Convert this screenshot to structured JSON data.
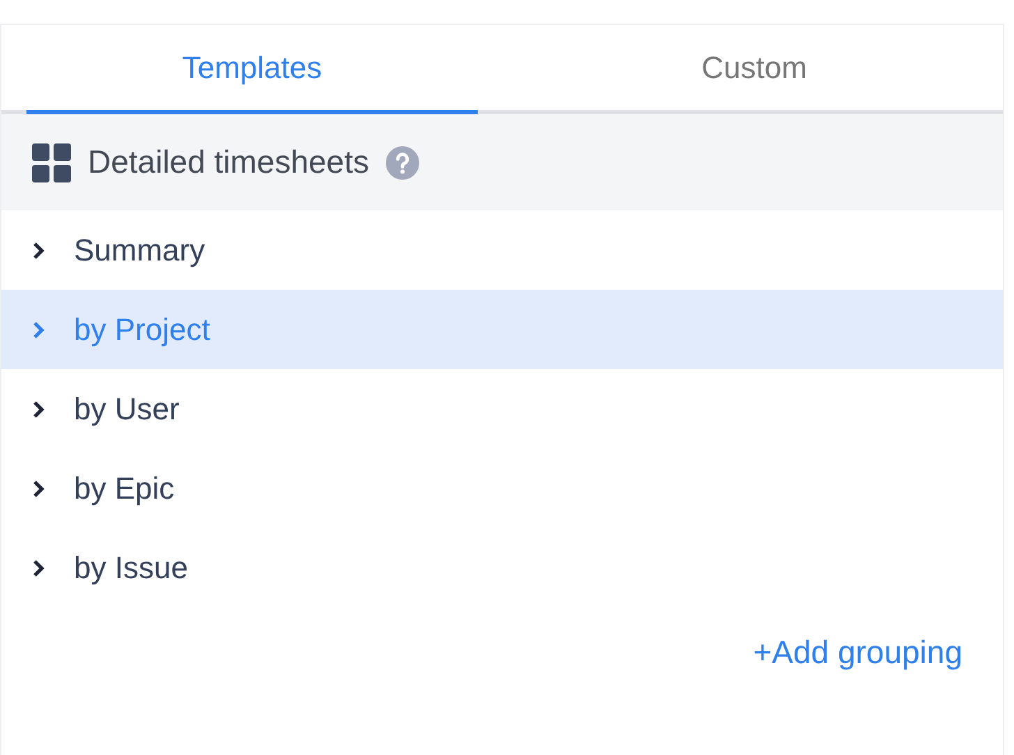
{
  "tabs": [
    {
      "label": "Templates",
      "selected": true
    },
    {
      "label": "Custom",
      "selected": false
    }
  ],
  "section": {
    "title": "Detailed timesheets"
  },
  "items": [
    {
      "label": "Summary",
      "selected": false
    },
    {
      "label": "by Project",
      "selected": true
    },
    {
      "label": "by User",
      "selected": false
    },
    {
      "label": "by Epic",
      "selected": false
    },
    {
      "label": "by Issue",
      "selected": false
    }
  ],
  "add_link": "+Add grouping"
}
